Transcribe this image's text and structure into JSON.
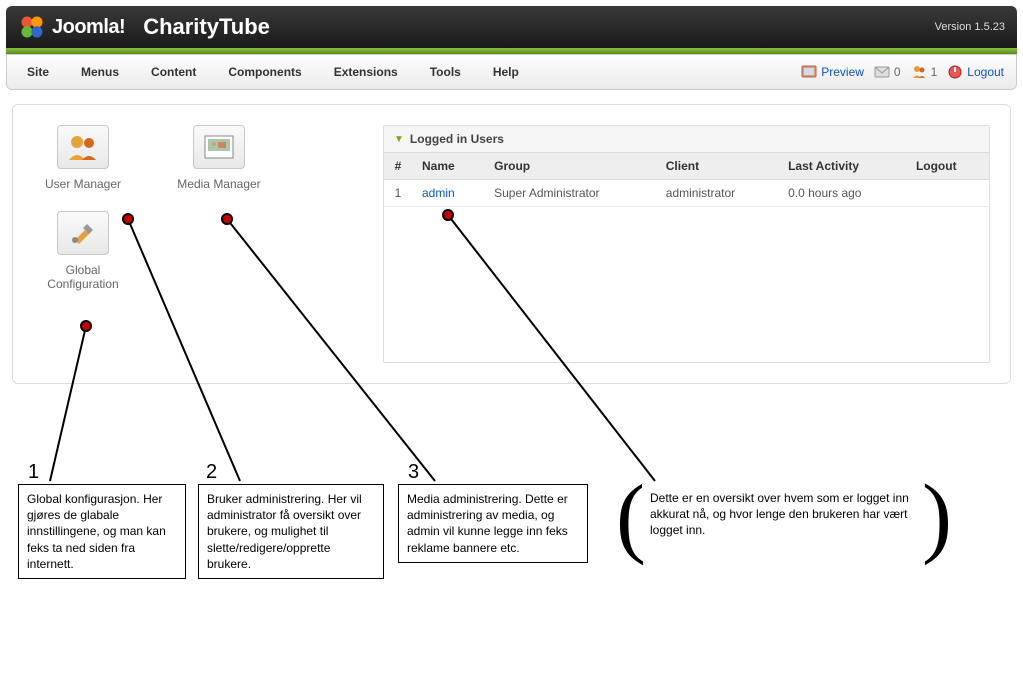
{
  "header": {
    "logo_text": "Joomla!",
    "site_name": "CharityTube",
    "version": "Version 1.5.23"
  },
  "menu": {
    "items": [
      "Site",
      "Menus",
      "Content",
      "Components",
      "Extensions",
      "Tools",
      "Help"
    ],
    "preview": "Preview",
    "messages_count": "0",
    "users_count": "1",
    "logout": "Logout"
  },
  "quick": {
    "user_manager": "User Manager",
    "media_manager": "Media Manager",
    "global_config": "Global Configuration"
  },
  "panel": {
    "title": "Logged in Users",
    "columns": {
      "num": "#",
      "name": "Name",
      "group": "Group",
      "client": "Client",
      "last": "Last Activity",
      "logout": "Logout"
    },
    "rows": [
      {
        "num": "1",
        "name": "admin",
        "group": "Super Administrator",
        "client": "administrator",
        "last": "0.0 hours ago",
        "logout": ""
      }
    ]
  },
  "annotations": {
    "n1": "1",
    "n2": "2",
    "n3": "3",
    "box1": "Global konfigurasjon. Her gjøres de glabale innstillingene, og man kan feks ta ned siden fra internett.",
    "box2": "Bruker administrering. Her vil administrator få oversikt over brukere, og mulighet til slette/redigere/opprette brukere.",
    "box3": "Media administrering. Dette er administrering av media, og admin vil kunne legge inn feks reklame bannere etc.",
    "box4": "Dette er en oversikt over hvem som er logget inn akkurat nå, og hvor lenge den brukeren har vært logget inn."
  }
}
